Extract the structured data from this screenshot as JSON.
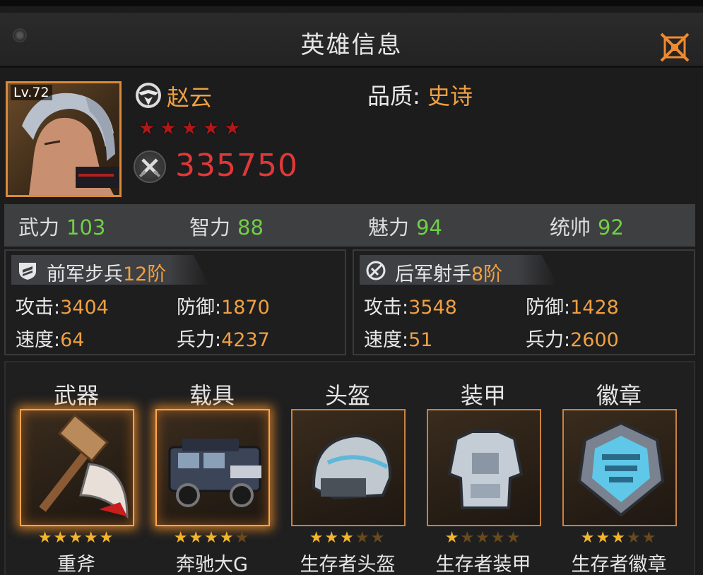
{
  "window": {
    "title": "英雄信息"
  },
  "hero": {
    "level": "Lv.72",
    "name": "赵云",
    "quality_label": "品质:",
    "quality_value": "史诗",
    "red_stars": "★★★★★",
    "power": "335750"
  },
  "attributes": [
    {
      "label": "武力",
      "value": "103"
    },
    {
      "label": "智力",
      "value": "88"
    },
    {
      "label": "魅力",
      "value": "94"
    },
    {
      "label": "统帅",
      "value": "92"
    }
  ],
  "troops": [
    {
      "name": "前军步兵",
      "tier": "12阶",
      "attack_label": "攻击:",
      "attack": "3404",
      "defense_label": "防御:",
      "defense": "1870",
      "speed_label": "速度:",
      "speed": "64",
      "force_label": "兵力:",
      "force": "4237"
    },
    {
      "name": "后军射手",
      "tier": "8阶",
      "attack_label": "攻击:",
      "attack": "3548",
      "defense_label": "防御:",
      "defense": "1428",
      "speed_label": "速度:",
      "speed": "51",
      "force_label": "兵力:",
      "force": "2600"
    }
  ],
  "equipment": [
    {
      "slot": "武器",
      "name": "重斧",
      "stars_on": "★★★★★",
      "stars_off": "",
      "icon": "axe-icon",
      "rating": 5
    },
    {
      "slot": "载具",
      "name": "奔驰大G",
      "stars_on": "★★★★",
      "stars_off": "★",
      "icon": "suv-icon",
      "rating": 4
    },
    {
      "slot": "头盔",
      "name": "生存者头盔",
      "stars_on": "★★★",
      "stars_off": "★★",
      "icon": "helmet-icon",
      "rating": 3
    },
    {
      "slot": "装甲",
      "name": "生存者装甲",
      "stars_on": "★",
      "stars_off": "★★★★",
      "icon": "armor-icon",
      "rating": 1
    },
    {
      "slot": "徽章",
      "name": "生存者徽章",
      "stars_on": "★★★",
      "stars_off": "★★",
      "icon": "badge-icon",
      "rating": 3
    }
  ],
  "colors": {
    "accent_orange": "#f0a040",
    "power_red": "#e03838",
    "attribute_green": "#6fd046",
    "star_gold": "#f3b52c"
  }
}
